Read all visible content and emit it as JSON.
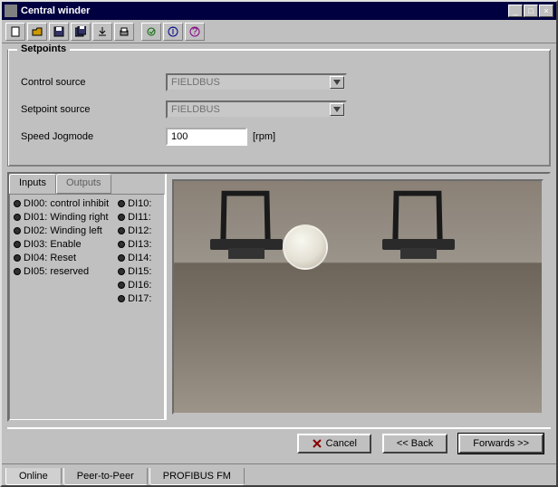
{
  "title": "Central winder",
  "setpoints": {
    "legend": "Setpoints",
    "control_label": "Control source",
    "control_value": "FIELDBUS",
    "setpoint_label": "Setpoint source",
    "setpoint_value": "FIELDBUS",
    "speed_label": "Speed Jogmode",
    "speed_value": "100",
    "speed_unit": "[rpm]"
  },
  "io": {
    "tab_inputs": "Inputs",
    "tab_outputs": "Outputs",
    "left": [
      "DI00: control inhibit",
      "DI01: Winding right",
      "DI02: Winding left",
      "DI03: Enable",
      "DI04: Reset",
      "DI05: reserved"
    ],
    "right": [
      "DI10:",
      "DI11:",
      "DI12:",
      "DI13:",
      "DI14:",
      "DI15:",
      "DI16:",
      "DI17:"
    ]
  },
  "nav": {
    "cancel": "Cancel",
    "back": "<< Back",
    "forward": "Forwards >>"
  },
  "bottom_tabs": {
    "online": "Online",
    "p2p": "Peer-to-Peer",
    "profibus": "PROFIBUS FM"
  }
}
